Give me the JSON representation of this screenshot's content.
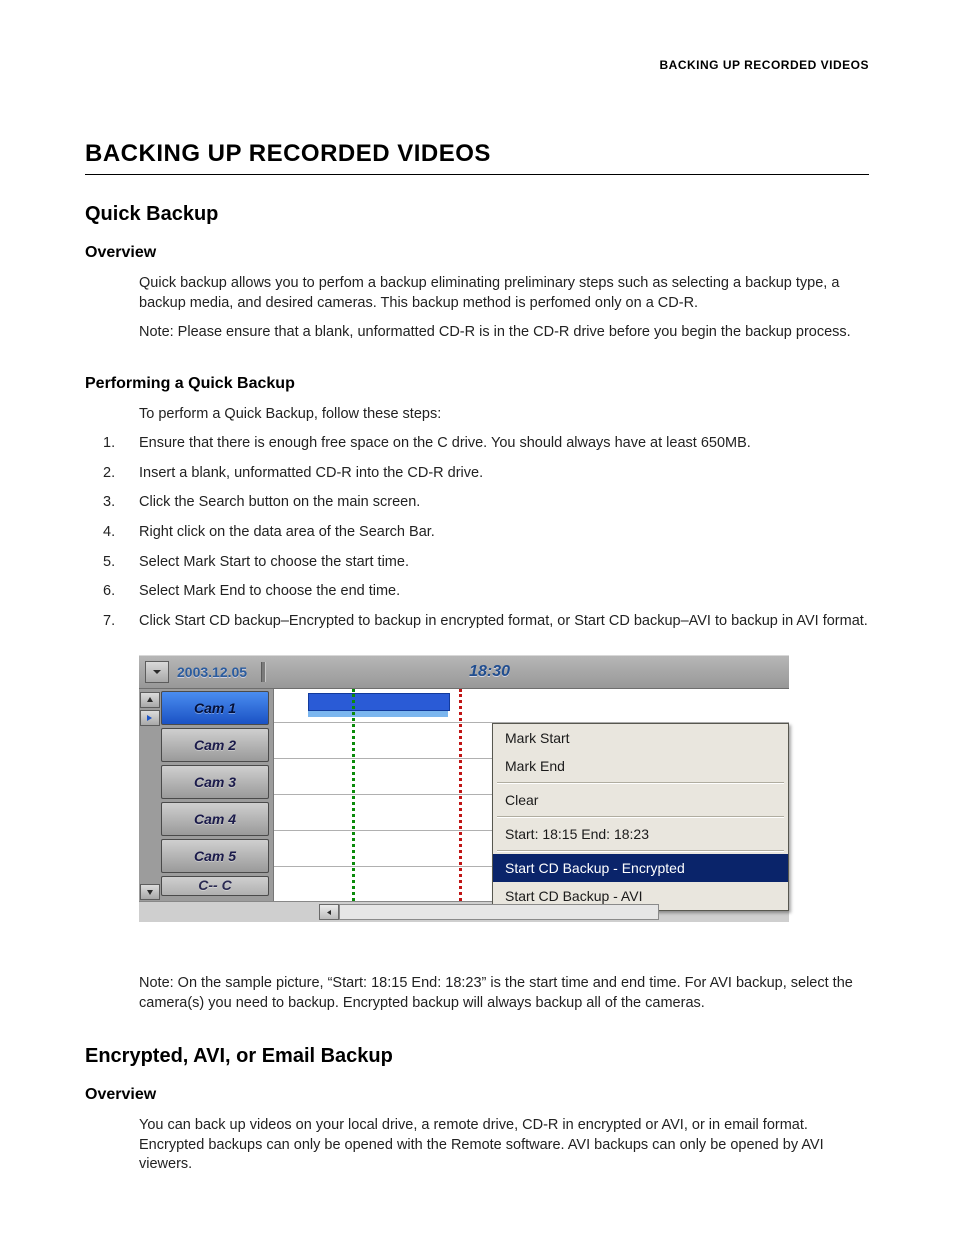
{
  "running_head": "BACKING UP RECORDED VIDEOS",
  "h1": "BACKING UP RECORDED VIDEOS",
  "quick": {
    "h2": "Quick Backup",
    "overview_h3": "Overview",
    "overview_p1": "Quick backup allows you to perfom a backup eliminating preliminary steps such as selecting a backup type, a backup media, and desired cameras. This backup method is perfomed only on a CD-R.",
    "overview_p2": "Note: Please ensure that a blank, unformatted CD-R is in the CD-R drive before you begin the backup process.",
    "perform_h3": "Performing a Quick Backup",
    "perform_intro": "To perform a Quick Backup, follow these steps:",
    "steps": [
      "Ensure that there is enough free space on the C drive. You should always have at least 650MB.",
      "Insert a blank, unformatted CD-R into the CD-R drive.",
      "Click the Search button on the main screen.",
      "Right click on the data area of the Search Bar.",
      "Select Mark Start to choose the start time.",
      "Select Mark End to choose the end time.",
      "Click Start CD backup–Encrypted to backup in encrypted format, or Start CD backup–AVI to backup in AVI format."
    ],
    "figure_note": "Note: On the sample picture, “Start: 18:15 End: 18:23” is the start time and end time. For AVI backup, select the camera(s) you need to backup. Encrypted backup will always backup all of the cameras."
  },
  "enc": {
    "h2": "Encrypted, AVI, or Email Backup",
    "overview_h3": "Overview",
    "overview_p1": "You can back up videos on your local drive, a remote drive, CD-R in encrypted or AVI, or in email format. Encrypted backups can only be opened with the Remote software. AVI backups can only be opened by AVI viewers."
  },
  "app": {
    "date": "2003.12.05",
    "time": "18:30",
    "cams": [
      "Cam 1",
      "Cam 2",
      "Cam 3",
      "Cam 4",
      "Cam 5"
    ],
    "cam_cut": "C-- C",
    "menu": {
      "mark_start": "Mark Start",
      "mark_end": "Mark End",
      "clear": "Clear",
      "range": "Start: 18:15  End: 18:23",
      "cd_enc": "Start CD Backup - Encrypted",
      "cd_avi": "Start CD Backup - AVI"
    }
  }
}
